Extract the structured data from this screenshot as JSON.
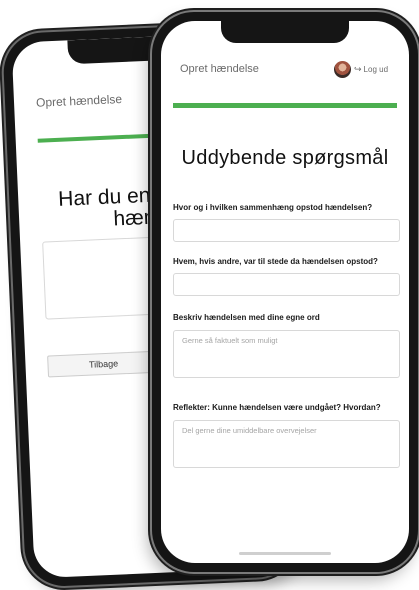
{
  "back_screen": {
    "header_title": "Opret hændelse",
    "question": "Har du en kommentar til hændelsen?",
    "back_button": "Tilbage"
  },
  "front_screen": {
    "header_title": "Opret hændelse",
    "logout_label": "Log ud",
    "heading": "Uddybende spørgsmål",
    "questions": [
      {
        "label": "Hvor og i hvilken sammenhæng opstod hændelsen?",
        "placeholder": ""
      },
      {
        "label": "Hvem, hvis andre, var til stede da hændelsen opstod?",
        "placeholder": ""
      },
      {
        "label": "Beskriv hændelsen med dine egne ord",
        "placeholder": "Gerne så faktuelt som muligt"
      },
      {
        "label": "Reflekter: Kunne hændelsen være undgået? Hvordan?",
        "placeholder": "Del gerne dine umiddelbare overvejelser"
      }
    ]
  },
  "colors": {
    "accent": "#4caf50",
    "phone_frame": "#151515",
    "muted_text": "#6b6b6b"
  },
  "icons": {
    "logout": "logout-icon",
    "avatar": "user-avatar"
  }
}
